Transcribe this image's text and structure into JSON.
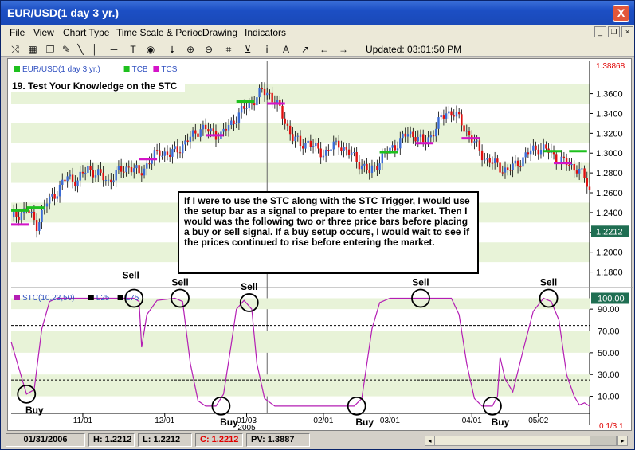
{
  "window": {
    "title": "EUR/USD(1 day  3 yr.)",
    "close_label": "X"
  },
  "menu": [
    "File",
    "View",
    "Chart Type",
    "Time Scale & Period",
    "Drawing",
    "Indicators"
  ],
  "toolbar": {
    "updated": "Updated: 03:01:50 PM"
  },
  "status": {
    "date": "01/31/2006",
    "high": "H: 1.2212",
    "low": "L: 1.2212",
    "close": "C: 1.2212",
    "pv": "PV: 1.3887"
  },
  "colors": {
    "up_bar": "#3a6bd6",
    "down_bar": "#e01010",
    "tcb": "#1ec01e",
    "tcs": "#d414c8",
    "stc_line": "#b41eb4",
    "grid_band": "#e8f3d8"
  },
  "chart_data": [
    {
      "type": "candlestick",
      "legend": [
        {
          "label": "EUR/USD(1 day  3 yr.)",
          "color": "#1ec01e"
        },
        {
          "label": "TCB",
          "color": "#1ec01e"
        },
        {
          "label": "TCS",
          "color": "#d414c8"
        }
      ],
      "panel_title": "19. Test Your Knowledge on the STC",
      "y_ticks": [
        "1.3600",
        "1.3400",
        "1.3200",
        "1.3000",
        "1.2800",
        "1.2600",
        "1.2400",
        "1.2200",
        "1.2000",
        "1.1800"
      ],
      "ylim": [
        1.17,
        1.3886
      ],
      "last_price_label": "1.2212",
      "top_right_label": "1.38868",
      "close_path": [
        [
          0,
          1.235
        ],
        [
          6,
          1.243
        ],
        [
          10,
          1.228
        ],
        [
          14,
          1.25
        ],
        [
          18,
          1.262
        ],
        [
          22,
          1.276
        ],
        [
          26,
          1.272
        ],
        [
          30,
          1.285
        ],
        [
          34,
          1.278
        ],
        [
          38,
          1.272
        ],
        [
          42,
          1.281
        ],
        [
          46,
          1.287
        ],
        [
          50,
          1.279
        ],
        [
          54,
          1.292
        ],
        [
          58,
          1.302
        ],
        [
          62,
          1.298
        ],
        [
          66,
          1.306
        ],
        [
          70,
          1.315
        ],
        [
          74,
          1.326
        ],
        [
          78,
          1.321
        ],
        [
          82,
          1.318
        ],
        [
          86,
          1.33
        ],
        [
          90,
          1.342
        ],
        [
          94,
          1.352
        ],
        [
          98,
          1.362
        ],
        [
          101,
          1.36
        ],
        [
          104,
          1.348
        ],
        [
          107,
          1.332
        ],
        [
          110,
          1.316
        ],
        [
          113,
          1.308
        ],
        [
          116,
          1.312
        ],
        [
          119,
          1.304
        ],
        [
          122,
          1.3
        ],
        [
          125,
          1.305
        ],
        [
          128,
          1.31
        ],
        [
          131,
          1.302
        ],
        [
          134,
          1.296
        ],
        [
          137,
          1.288
        ],
        [
          140,
          1.28
        ],
        [
          143,
          1.29
        ],
        [
          146,
          1.298
        ],
        [
          149,
          1.306
        ],
        [
          152,
          1.312
        ],
        [
          155,
          1.32
        ],
        [
          158,
          1.318
        ],
        [
          161,
          1.31
        ],
        [
          164,
          1.318
        ],
        [
          167,
          1.33
        ],
        [
          170,
          1.342
        ],
        [
          173,
          1.34
        ],
        [
          176,
          1.33
        ],
        [
          179,
          1.318
        ],
        [
          182,
          1.306
        ],
        [
          185,
          1.295
        ],
        [
          188,
          1.29
        ],
        [
          191,
          1.286
        ],
        [
          194,
          1.282
        ],
        [
          197,
          1.288
        ],
        [
          200,
          1.295
        ],
        [
          203,
          1.302
        ],
        [
          206,
          1.306
        ],
        [
          209,
          1.303
        ],
        [
          212,
          1.298
        ],
        [
          215,
          1.292
        ],
        [
          218,
          1.288
        ],
        [
          221,
          1.285
        ],
        [
          224,
          1.275
        ],
        [
          226,
          1.262
        ]
      ],
      "tcb_marks": [
        [
          0,
          1.242
        ],
        [
          6,
          1.245
        ],
        [
          88,
          1.352
        ],
        [
          144,
          1.301
        ],
        [
          208,
          1.302
        ],
        [
          218,
          1.302
        ]
      ],
      "tcs_marks": [
        [
          0,
          1.228
        ],
        [
          50,
          1.294
        ],
        [
          76,
          1.318
        ],
        [
          100,
          1.35
        ],
        [
          158,
          1.31
        ],
        [
          176,
          1.315
        ],
        [
          212,
          1.29
        ]
      ],
      "annotation": "If I were to use the STC along with the STC Trigger, I would use the setup bar as a signal to prepare to enter the market. Then I would was the following two or three price bars before placing a buy or sell signal.  If a buy setup occurs, I would wait to see if the prices continued to rise before entering the market."
    },
    {
      "type": "line",
      "legend": [
        {
          "label": "STC(10,23,50)",
          "color": "#b41eb4"
        },
        {
          "label": "L25",
          "color": "#000000"
        },
        {
          "label": "L75",
          "color": "#000000"
        }
      ],
      "y_ticks": [
        "100.00",
        "90.00",
        "70.00",
        "50.00",
        "30.00",
        "10.00"
      ],
      "ylim": [
        -2,
        104
      ],
      "reference_lines": [
        75,
        25
      ],
      "last_value_label": "100.00",
      "series": [
        {
          "name": "STC(10,23,50)",
          "points": [
            [
              0,
              60
            ],
            [
              3,
              36
            ],
            [
              6,
              12
            ],
            [
              9,
              16
            ],
            [
              12,
              72
            ],
            [
              15,
              97
            ],
            [
              18,
              100
            ],
            [
              48,
              100
            ],
            [
              50,
              97
            ],
            [
              51,
              55
            ],
            [
              53,
              85
            ],
            [
              57,
              98
            ],
            [
              64,
              100
            ],
            [
              67,
              97
            ],
            [
              70,
              40
            ],
            [
              73,
              6
            ],
            [
              76,
              1
            ],
            [
              80,
              1
            ],
            [
              83,
              12
            ],
            [
              86,
              58
            ],
            [
              88,
              90
            ],
            [
              91,
              98
            ],
            [
              94,
              90
            ],
            [
              96,
              40
            ],
            [
              99,
              8
            ],
            [
              103,
              1
            ],
            [
              134,
              1
            ],
            [
              137,
              8
            ],
            [
              141,
              72
            ],
            [
              144,
              96
            ],
            [
              148,
              100
            ],
            [
              172,
              100
            ],
            [
              175,
              85
            ],
            [
              178,
              40
            ],
            [
              181,
              8
            ],
            [
              184,
              1
            ],
            [
              188,
              1
            ],
            [
              190,
              10
            ],
            [
              191,
              46
            ],
            [
              193,
              26
            ],
            [
              196,
              14
            ],
            [
              200,
              52
            ],
            [
              204,
              88
            ],
            [
              208,
              100
            ],
            [
              211,
              97
            ],
            [
              214,
              80
            ],
            [
              217,
              30
            ],
            [
              220,
              10
            ],
            [
              222,
              2
            ],
            [
              224,
              4
            ],
            [
              226,
              1
            ]
          ]
        }
      ],
      "annotations": [
        {
          "text": "Sell",
          "x": 48,
          "y": 100,
          "dir": "up-high"
        },
        {
          "text": "Sell",
          "x": 66,
          "y": 100,
          "dir": "up"
        },
        {
          "text": "Sell",
          "x": 93,
          "y": 96,
          "dir": "up"
        },
        {
          "text": "Sell",
          "x": 160,
          "y": 100,
          "dir": "up"
        },
        {
          "text": "Sell",
          "x": 210,
          "y": 100,
          "dir": "up"
        },
        {
          "text": "Buy",
          "x": 6,
          "y": 12,
          "dir": "down"
        },
        {
          "text": "Buy",
          "x": 82,
          "y": 1,
          "dir": "down"
        },
        {
          "text": "Buy",
          "x": 135,
          "y": 1,
          "dir": "down"
        },
        {
          "text": "Buy",
          "x": 188,
          "y": 1,
          "dir": "down"
        }
      ]
    }
  ],
  "x_axis": {
    "labels": [
      {
        "text": "11/01",
        "x": 28
      },
      {
        "text": "12/01",
        "x": 60
      },
      {
        "text": "01/03",
        "x": 92,
        "sub": "2005"
      },
      {
        "text": "02/01",
        "x": 122
      },
      {
        "text": "03/01",
        "x": 148
      },
      {
        "text": "04/01",
        "x": 180
      },
      {
        "text": "05/02",
        "x": 206
      }
    ],
    "corner_label": "0 1/3 1",
    "xlim": [
      0,
      226
    ]
  }
}
